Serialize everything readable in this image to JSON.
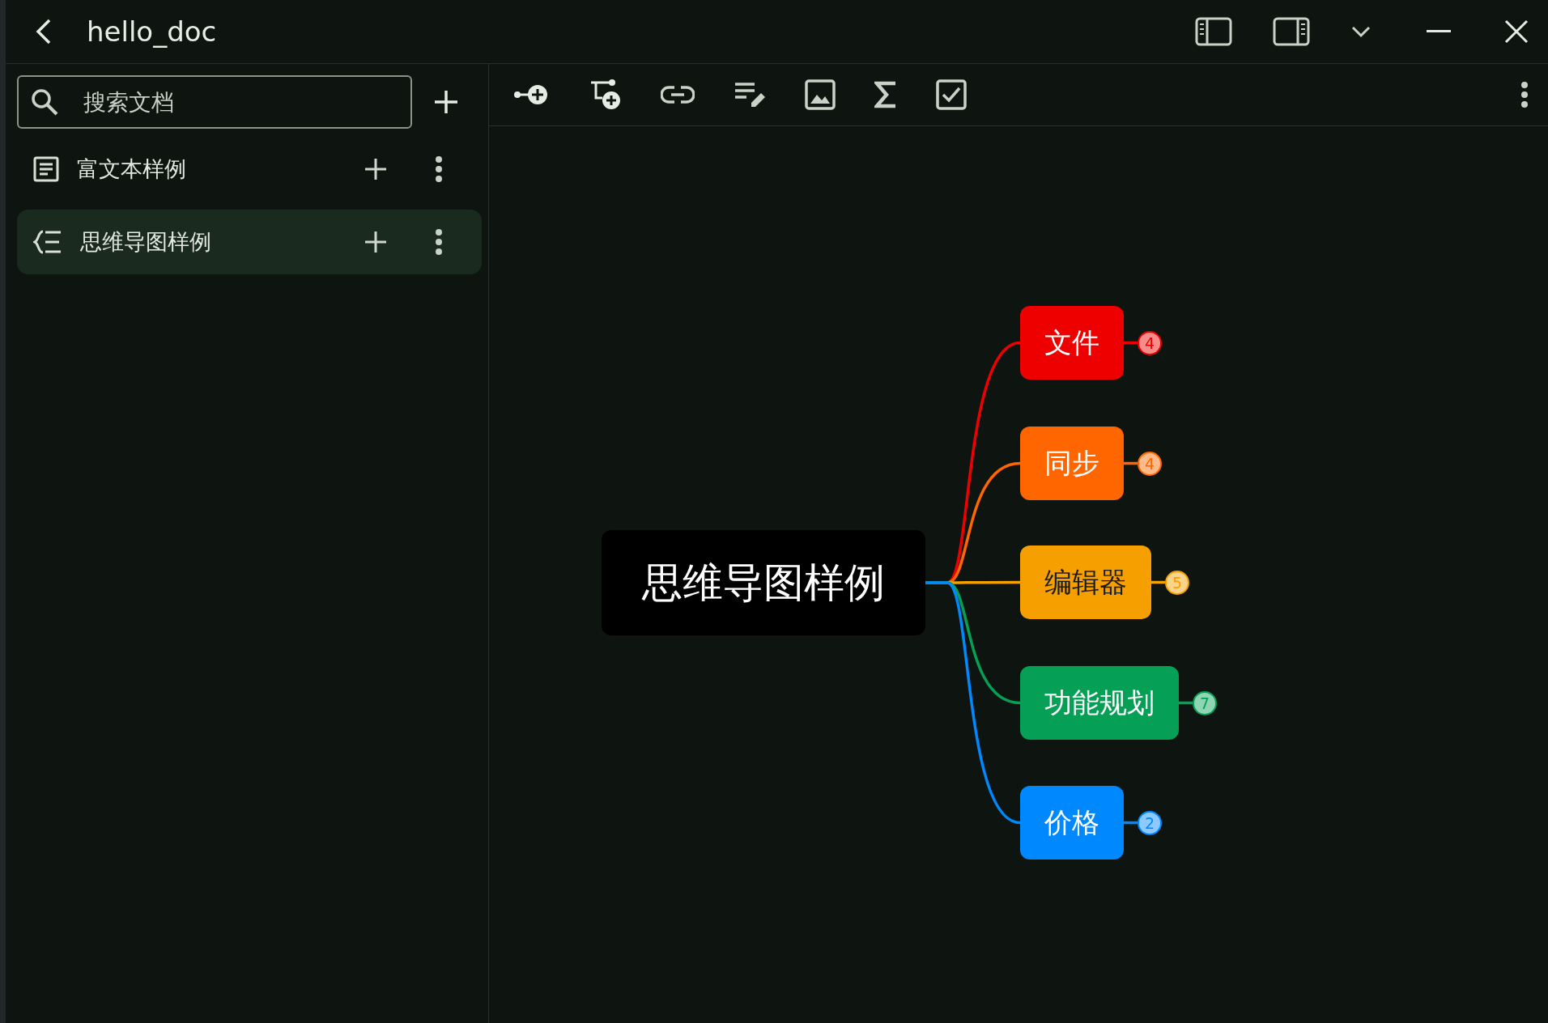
{
  "window": {
    "title": "hello_doc"
  },
  "sidebar": {
    "search": {
      "placeholder": "搜索文档"
    },
    "documents": [
      {
        "kind": "richtext",
        "title": "富文本样例",
        "selected": false
      },
      {
        "kind": "mindmap",
        "title": "思维导图样例",
        "selected": true
      }
    ]
  },
  "mindmap": {
    "root": "思维导图样例",
    "branches": [
      {
        "label": "文件",
        "color": "#ee0000",
        "count": "4"
      },
      {
        "label": "同步",
        "color": "#ff6600",
        "count": "4"
      },
      {
        "label": "编辑器",
        "color": "#f5a000",
        "count": "5"
      },
      {
        "label": "功能规划",
        "color": "#05a055",
        "count": "7"
      },
      {
        "label": "价格",
        "color": "#0088ff",
        "count": "2"
      }
    ]
  }
}
